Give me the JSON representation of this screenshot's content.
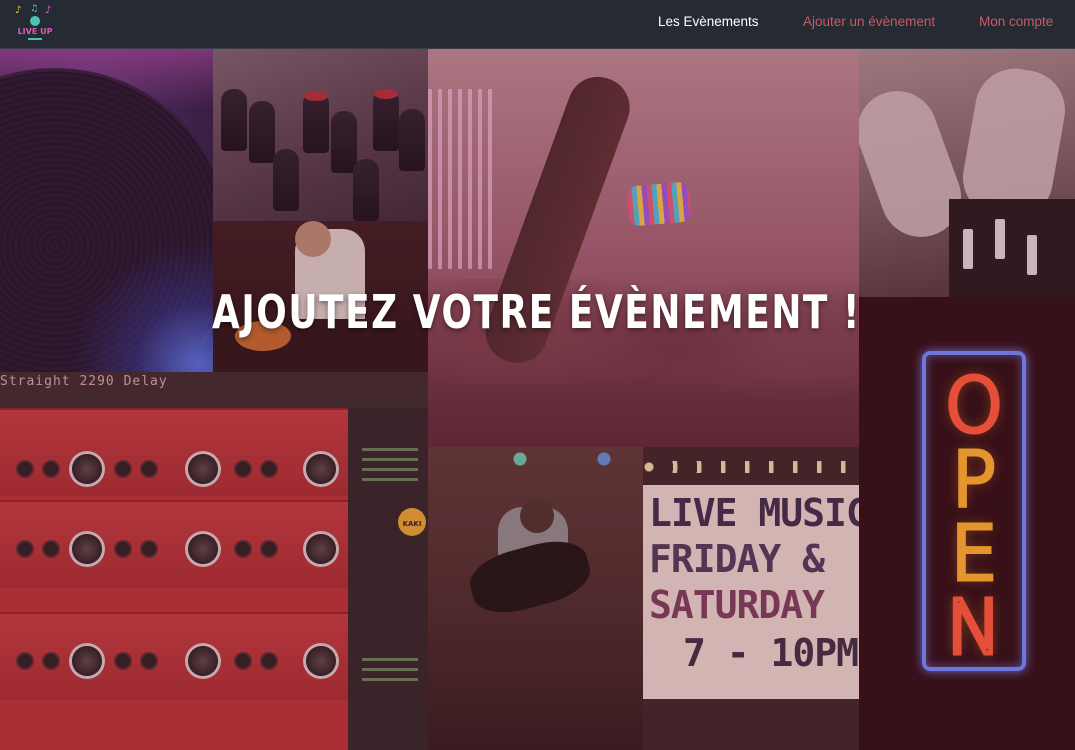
{
  "header": {
    "logo_text": "LIVE UP",
    "nav": {
      "events": "Les Evènements",
      "add_event": "Ajouter un évènement",
      "account": "Mon compte"
    },
    "colors": {
      "bar": "#262b33",
      "active_link": "#ffffff",
      "link": "#c65a66"
    }
  },
  "hero": {
    "title": "AJOUTEZ VOTRE ÉVÈNEMENT !"
  },
  "collage": {
    "rack_display": "Straight 2290 Delay",
    "rack_brand": "KAKI",
    "marquee_lines": [
      "LIVE MUSIC",
      "FRIDAY &",
      "SATURDAY",
      "7 - 10PM"
    ],
    "neon_sign": [
      "O",
      "P",
      "E",
      "N"
    ]
  }
}
